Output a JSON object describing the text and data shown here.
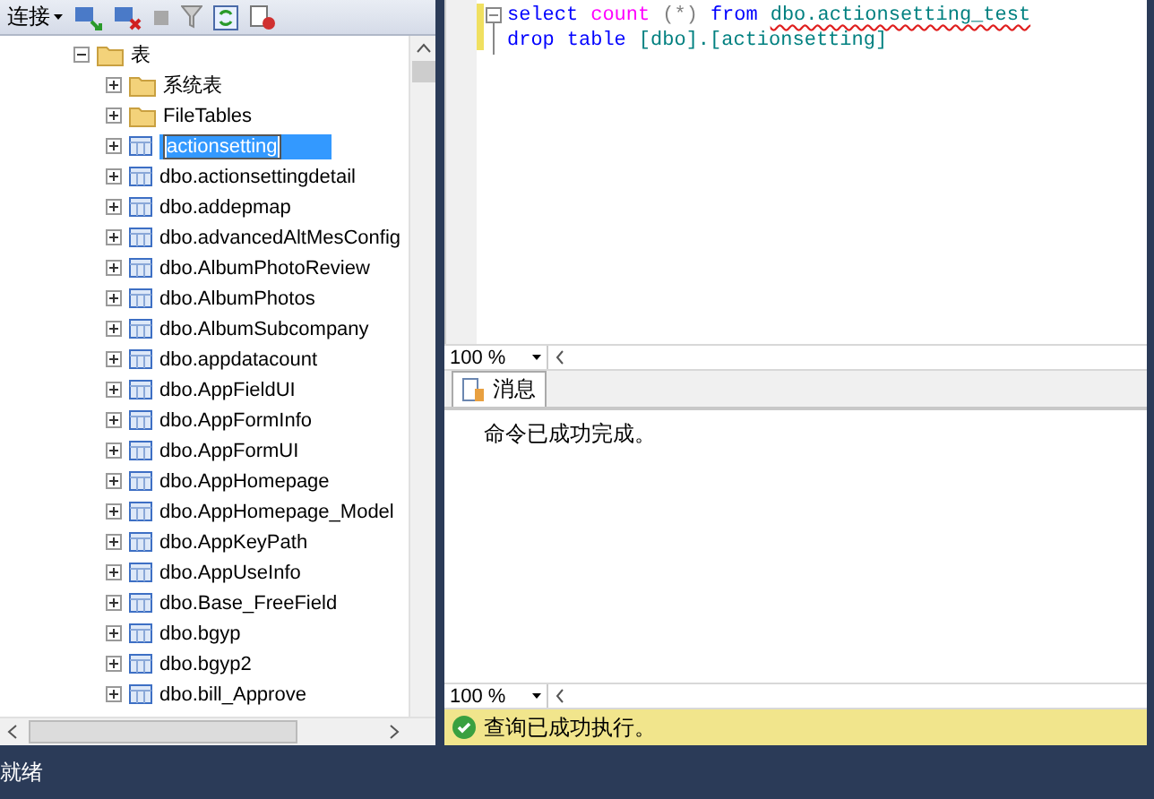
{
  "toolbar": {
    "connect_label": "连接"
  },
  "tree": {
    "label": "表",
    "expanded": true,
    "children": [
      {
        "label": "系统表",
        "kind": "folder",
        "selected": false
      },
      {
        "label": "FileTables",
        "kind": "folder",
        "selected": false
      },
      {
        "label": "actionsetting",
        "kind": "table",
        "selected": true
      },
      {
        "label": "dbo.actionsettingdetail",
        "kind": "table",
        "selected": false
      },
      {
        "label": "dbo.addepmap",
        "kind": "table",
        "selected": false
      },
      {
        "label": "dbo.advancedAltMesConfig",
        "kind": "table",
        "selected": false
      },
      {
        "label": "dbo.AlbumPhotoReview",
        "kind": "table",
        "selected": false
      },
      {
        "label": "dbo.AlbumPhotos",
        "kind": "table",
        "selected": false
      },
      {
        "label": "dbo.AlbumSubcompany",
        "kind": "table",
        "selected": false
      },
      {
        "label": "dbo.appdatacount",
        "kind": "table",
        "selected": false
      },
      {
        "label": "dbo.AppFieldUI",
        "kind": "table",
        "selected": false
      },
      {
        "label": "dbo.AppFormInfo",
        "kind": "table",
        "selected": false
      },
      {
        "label": "dbo.AppFormUI",
        "kind": "table",
        "selected": false
      },
      {
        "label": "dbo.AppHomepage",
        "kind": "table",
        "selected": false
      },
      {
        "label": "dbo.AppHomepage_Model",
        "kind": "table",
        "selected": false
      },
      {
        "label": "dbo.AppKeyPath",
        "kind": "table",
        "selected": false
      },
      {
        "label": "dbo.AppUseInfo",
        "kind": "table",
        "selected": false
      },
      {
        "label": "dbo.Base_FreeField",
        "kind": "table",
        "selected": false
      },
      {
        "label": "dbo.bgyp",
        "kind": "table",
        "selected": false
      },
      {
        "label": "dbo.bgyp2",
        "kind": "table",
        "selected": false
      },
      {
        "label": "dbo.bill_Approve",
        "kind": "table",
        "selected": false
      }
    ]
  },
  "editor": {
    "lines": [
      [
        {
          "text": "select",
          "kind": "keyword"
        },
        {
          "text": "count",
          "kind": "function"
        },
        {
          "text": "(*)",
          "kind": "operator"
        },
        {
          "text": "from",
          "kind": "keyword"
        },
        {
          "text": "dbo.actionsetting_test",
          "kind": "identifier",
          "error": true
        }
      ],
      [
        {
          "text": "drop",
          "kind": "keyword"
        },
        {
          "text": "table",
          "kind": "keyword"
        },
        {
          "text": "[dbo].[actionsetting]",
          "kind": "identifier",
          "error": false
        }
      ]
    ],
    "zoom": "100 %"
  },
  "results": {
    "tabs": [
      {
        "label": "消息",
        "selected": true
      }
    ],
    "message": "命令已成功完成。",
    "zoom": "100 %"
  },
  "query_status": {
    "text": "查询已成功执行。",
    "success": true
  },
  "status_bar": {
    "text": "就绪"
  }
}
